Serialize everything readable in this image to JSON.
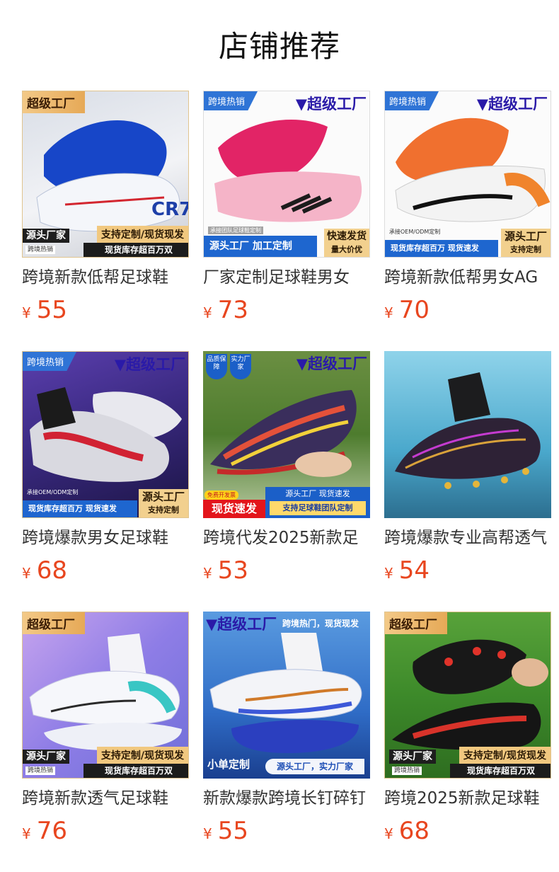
{
  "page": {
    "title": "店铺推荐"
  },
  "currency_symbol": "¥",
  "colors": {
    "price": "#e8461f",
    "brand_blue": "#2a1aa8",
    "gold": "#f1c87f"
  },
  "products": [
    {
      "name": "跨境新款低帮足球鞋",
      "price": "55",
      "overlay": {
        "top_left": "超级工厂",
        "bottom_left": "源头厂家",
        "bottom_left_sub": "跨境热销",
        "bottom_right": "支持定制/现货现发",
        "bottom_strip": "现货库存超百万双"
      }
    },
    {
      "name": "厂家定制足球鞋男女",
      "price": "73",
      "overlay": {
        "top_left": "跨境热销",
        "brand": "超级工厂",
        "small_note": "承接团队足球鞋定制",
        "blue_strip": "源头工厂 加工定制",
        "gold_top": "快速发货",
        "gold_bottom": "量大价优"
      }
    },
    {
      "name": "跨境新款低帮男女AG",
      "price": "70",
      "overlay": {
        "top_left": "跨境热销",
        "brand": "超级工厂",
        "small_note": "承接OEM/ODM定制",
        "blue_strip": "现货库存超百万 现货速发",
        "gold_top": "源头工厂",
        "gold_bottom": "支持定制"
      }
    },
    {
      "name": "跨境爆款男女足球鞋",
      "price": "68",
      "overlay": {
        "top_left": "跨境热销",
        "brand": "超级工厂",
        "small_note": "承接OEM/ODM定制",
        "blue_strip": "现货库存超百万 现货速发",
        "gold_top": "源头工厂",
        "gold_bottom": "支持定制"
      }
    },
    {
      "name": "跨境代发2025新款足",
      "price": "53",
      "overlay": {
        "badge_1": "品质保障",
        "badge_2": "实力厂家",
        "brand": "超级工厂",
        "red_tag": "免费开发票",
        "red_big": "现货速发",
        "blue_line_1": "源头工厂 现货速发",
        "blue_line_2": "支持足球鞋团队定制"
      }
    },
    {
      "name": "跨境爆款专业高帮透气",
      "price": "54",
      "overlay": {}
    },
    {
      "name": "跨境新款透气足球鞋",
      "price": "76",
      "overlay": {
        "top_left": "超级工厂",
        "bottom_left": "源头厂家",
        "bottom_left_sub": "跨境热销",
        "bottom_right": "支持定制/现货现发",
        "bottom_strip": "现货库存超百万双"
      }
    },
    {
      "name": "新款爆款跨境长钉碎钉",
      "price": "55",
      "overlay": {
        "brand": "超级工厂",
        "top_right_text": "跨境热门，现货现发",
        "bottom_left_big": "小单定制",
        "bottom_right_pill": "源头工厂，实力厂家"
      }
    },
    {
      "name": "跨境2025新款足球鞋",
      "price": "68",
      "overlay": {
        "top_left": "超级工厂",
        "bottom_left": "源头厂家",
        "bottom_left_sub": "跨境热销",
        "bottom_right": "支持定制/现货现发",
        "bottom_strip": "现货库存超百万双"
      }
    }
  ]
}
